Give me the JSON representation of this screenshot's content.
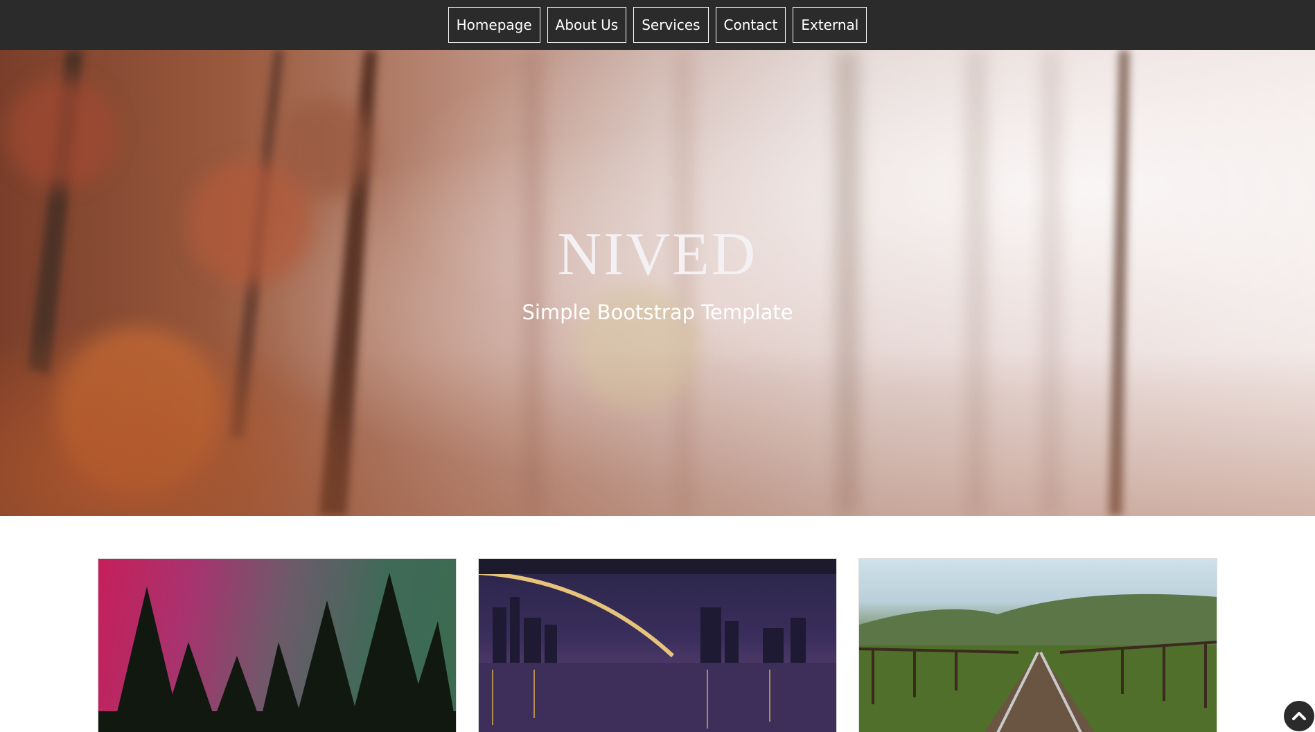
{
  "nav": {
    "items": [
      {
        "label": "Homepage"
      },
      {
        "label": "About Us"
      },
      {
        "label": "Services"
      },
      {
        "label": "Contact"
      },
      {
        "label": "External"
      }
    ]
  },
  "hero": {
    "title": "NIVED",
    "subtitle": "Simple Bootstrap Template"
  },
  "cards": [
    {
      "image": "aurora-forest-image"
    },
    {
      "image": "city-bridge-night-image"
    },
    {
      "image": "railway-bridge-image"
    }
  ],
  "scroll_top": {
    "icon": "chevron-up-icon"
  },
  "colors": {
    "navbar_bg": "#2b2b2b",
    "nav_border": "#ffffff",
    "hero_title": "#f4f1f4",
    "page_bg": "#ffffff"
  }
}
